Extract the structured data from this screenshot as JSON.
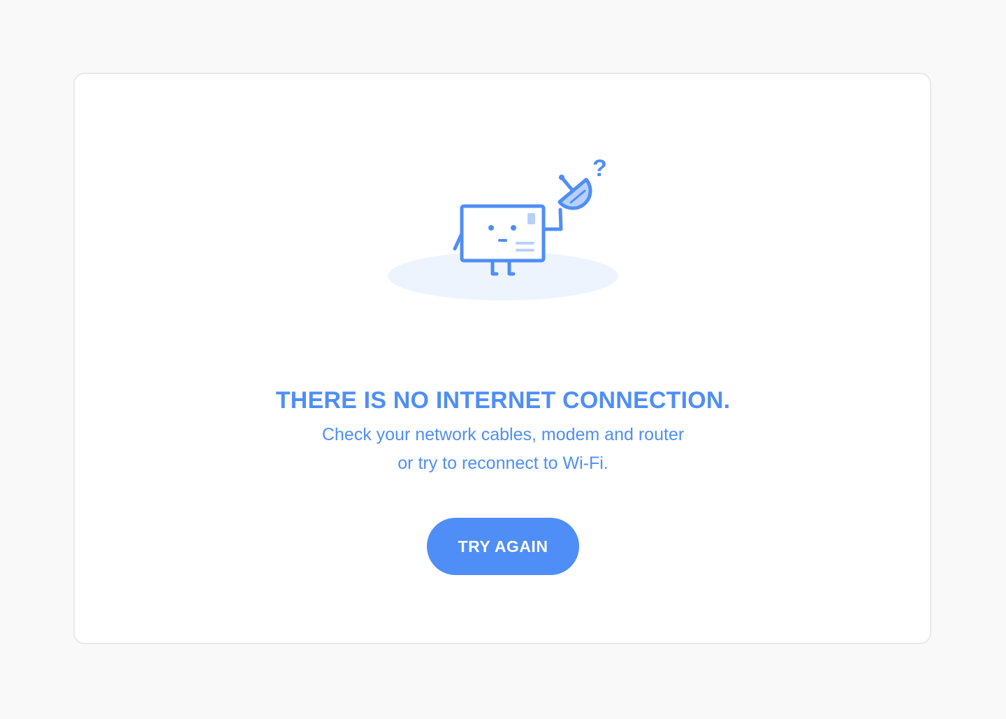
{
  "error": {
    "title": "THERE IS NO INTERNET CONNECTION.",
    "description_lines": [
      "Check your network cables, modem and router",
      "or try to reconnect to Wi-Fi."
    ],
    "retry_button_label": "TRY AGAIN"
  },
  "illustration": {
    "icon": "disconnected-router-mascot-icon",
    "question_mark": "?"
  },
  "colors": {
    "accent": "#4f8ef6",
    "accent_light": "#b8d0fb",
    "ground_shadow": "#eef4fe",
    "page_background": "#f9f9f9",
    "card_background": "#ffffff",
    "card_border": "#e9e9e9"
  }
}
